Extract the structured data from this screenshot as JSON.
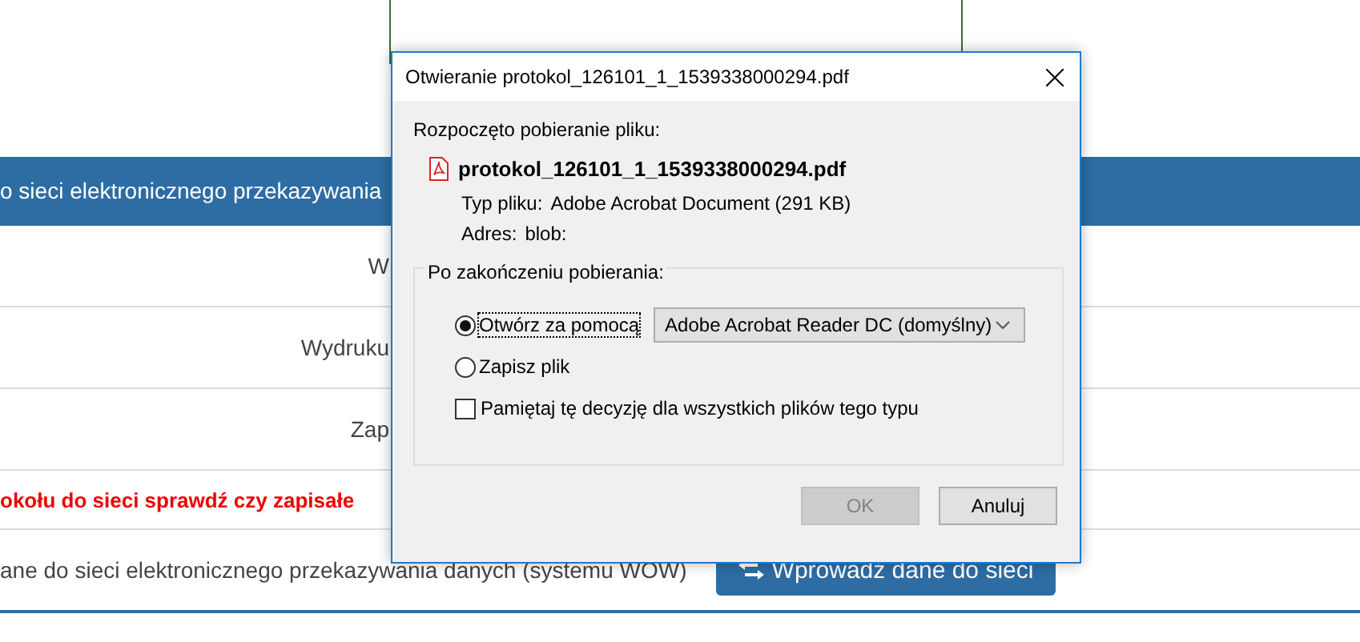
{
  "page": {
    "header": "o sieci elektronicznego przekazywania",
    "rows": [
      {
        "kind": "label",
        "text": "W"
      },
      {
        "kind": "label",
        "text": "Wydruku"
      },
      {
        "kind": "label",
        "text": "Zap"
      },
      {
        "kind": "warning",
        "text": "okołu do sieci sprawdź czy zapisałe"
      },
      {
        "kind": "action",
        "text": "ane do sieci elektronicznego przekazywania danych (systemu WOW)",
        "button": "Wprowadź dane do sieci"
      }
    ]
  },
  "dialog": {
    "title": "Otwieranie protokol_126101_1_1539338000294.pdf",
    "intro": "Rozpoczęto pobieranie pliku:",
    "file_name": "protokol_126101_1_1539338000294.pdf",
    "type_label": "Typ pliku:",
    "type_value": "Adobe Acrobat Document (291 KB)",
    "address_label": "Adres:",
    "address_value": "blob:",
    "group_title": "Po zakończeniu pobierania:",
    "options": [
      {
        "label": "Otwórz za pomocą",
        "selected": true,
        "app": "Adobe Acrobat Reader DC  (domyślny)"
      },
      {
        "label": "Zapisz plik",
        "selected": false
      }
    ],
    "remember": {
      "label": "Pamiętaj tę decyzję dla wszystkich plików tego typu",
      "checked": false
    },
    "buttons": [
      {
        "label": "OK",
        "disabled": true
      },
      {
        "label": "Anuluj",
        "disabled": false
      }
    ]
  }
}
